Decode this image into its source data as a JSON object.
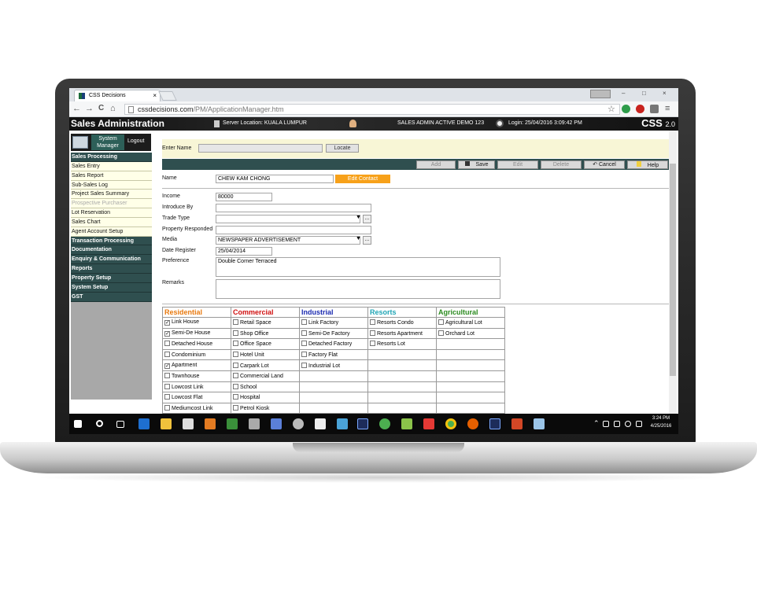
{
  "browser": {
    "tab_title": "CSS Decisions",
    "tab_close": "×",
    "url_host": "cssdecisions.com",
    "url_path": "/PM/ApplicationManager.htm",
    "back": "←",
    "forward": "→",
    "reload": "C",
    "home": "⌂",
    "star": "☆",
    "menu": "≡",
    "win_min": "–",
    "win_max": "□",
    "win_close": "×"
  },
  "app": {
    "title": "Sales Administration",
    "server_location": "Server Location: KUALA LUMPUR",
    "session": "SALES ADMIN ACTIVE DEMO    123",
    "login": "Login: 25/04/2016 3:09:42 PM",
    "brand": "CSS",
    "brand_version": "2.0"
  },
  "sidebar": {
    "system_manager": "System Manager",
    "logout": "Logout",
    "items": [
      {
        "label": "Sales Processing",
        "type": "header"
      },
      {
        "label": "Sales Entry",
        "type": "item"
      },
      {
        "label": "Sales Report",
        "type": "item"
      },
      {
        "label": "Sub-Sales Log",
        "type": "item"
      },
      {
        "label": "Project Sales Summary",
        "type": "item"
      },
      {
        "label": "Prospective Purchaser",
        "type": "disabled"
      },
      {
        "label": "Lot Reservation",
        "type": "item"
      },
      {
        "label": "Sales Chart",
        "type": "item"
      },
      {
        "label": "Agent Account Setup",
        "type": "item"
      },
      {
        "label": "Transaction Processing",
        "type": "header"
      },
      {
        "label": "Documentation",
        "type": "header"
      },
      {
        "label": "Enquiry & Communication",
        "type": "header"
      },
      {
        "label": "Reports",
        "type": "header"
      },
      {
        "label": "Property Setup",
        "type": "header"
      },
      {
        "label": "System Setup",
        "type": "header"
      },
      {
        "label": "GST",
        "type": "header"
      }
    ]
  },
  "search": {
    "label": "Enter Name",
    "value": "",
    "locate_label": "Locate"
  },
  "actions": {
    "add": "Add",
    "save": "Save",
    "edit": "Edit",
    "delete": "Delete",
    "cancel": "Cancel",
    "help": "Help"
  },
  "form": {
    "name_label": "Name",
    "name_value": "CHEW KAM CHONG",
    "edit_contact": "Edit Contact",
    "income_label": "Income",
    "income_value": "80000",
    "introduce_label": "Introduce By",
    "introduce_value": "",
    "trade_label": "Trade Type",
    "trade_value": "",
    "property_label": "Property Responded",
    "property_value": "",
    "media_label": "Media",
    "media_value": "NEWSPAPER ADVERTISEMENT",
    "date_label": "Date Register",
    "date_value": "25/04/2014",
    "preference_label": "Preference",
    "preference_value": "Double Corner Terraced",
    "remarks_label": "Remarks",
    "remarks_value": "",
    "dots": "..."
  },
  "categories": {
    "headers": [
      {
        "label": "Residential",
        "color": "#e8790e"
      },
      {
        "label": "Commercial",
        "color": "#d01010"
      },
      {
        "label": "Industrial",
        "color": "#1a2ab0"
      },
      {
        "label": "Resorts",
        "color": "#1fa5b5"
      },
      {
        "label": "Agricultural",
        "color": "#2a8a1e"
      }
    ],
    "residential": [
      {
        "label": "Link House",
        "checked": true
      },
      {
        "label": "Semi-De House",
        "checked": true
      },
      {
        "label": "Detached House",
        "checked": false
      },
      {
        "label": "Condominium",
        "checked": false
      },
      {
        "label": "Apartment",
        "checked": true
      },
      {
        "label": "Townhouse",
        "checked": false
      },
      {
        "label": "Lowcost Link",
        "checked": false
      },
      {
        "label": "Lowcost Flat",
        "checked": false
      },
      {
        "label": "Mediumcost Link",
        "checked": false
      }
    ],
    "commercial": [
      {
        "label": "Retail Space",
        "checked": false
      },
      {
        "label": "Shop Office",
        "checked": false
      },
      {
        "label": "Office Space",
        "checked": false
      },
      {
        "label": "Hotel Unit",
        "checked": false
      },
      {
        "label": "Carpark Lot",
        "checked": false
      },
      {
        "label": "Commercial Land",
        "checked": false
      },
      {
        "label": "School",
        "checked": false
      },
      {
        "label": "Hospital",
        "checked": false
      },
      {
        "label": "Petrol Kiosk",
        "checked": false
      }
    ],
    "industrial": [
      {
        "label": "Link Factory",
        "checked": false
      },
      {
        "label": "Semi-De Factory",
        "checked": false
      },
      {
        "label": "Detached Factory",
        "checked": false
      },
      {
        "label": "Factory Flat",
        "checked": false
      },
      {
        "label": "Industrial Lot",
        "checked": false
      }
    ],
    "resorts": [
      {
        "label": "Resorts Condo",
        "checked": false
      },
      {
        "label": "Resorts Apartment",
        "checked": false
      },
      {
        "label": "Resorts Lot",
        "checked": false
      }
    ],
    "agricultural": [
      {
        "label": "Agricultural Lot",
        "checked": false
      },
      {
        "label": "Orchard Lot",
        "checked": false
      }
    ]
  },
  "taskbar": {
    "time": "3:24 PM",
    "date": "4/25/2016"
  }
}
